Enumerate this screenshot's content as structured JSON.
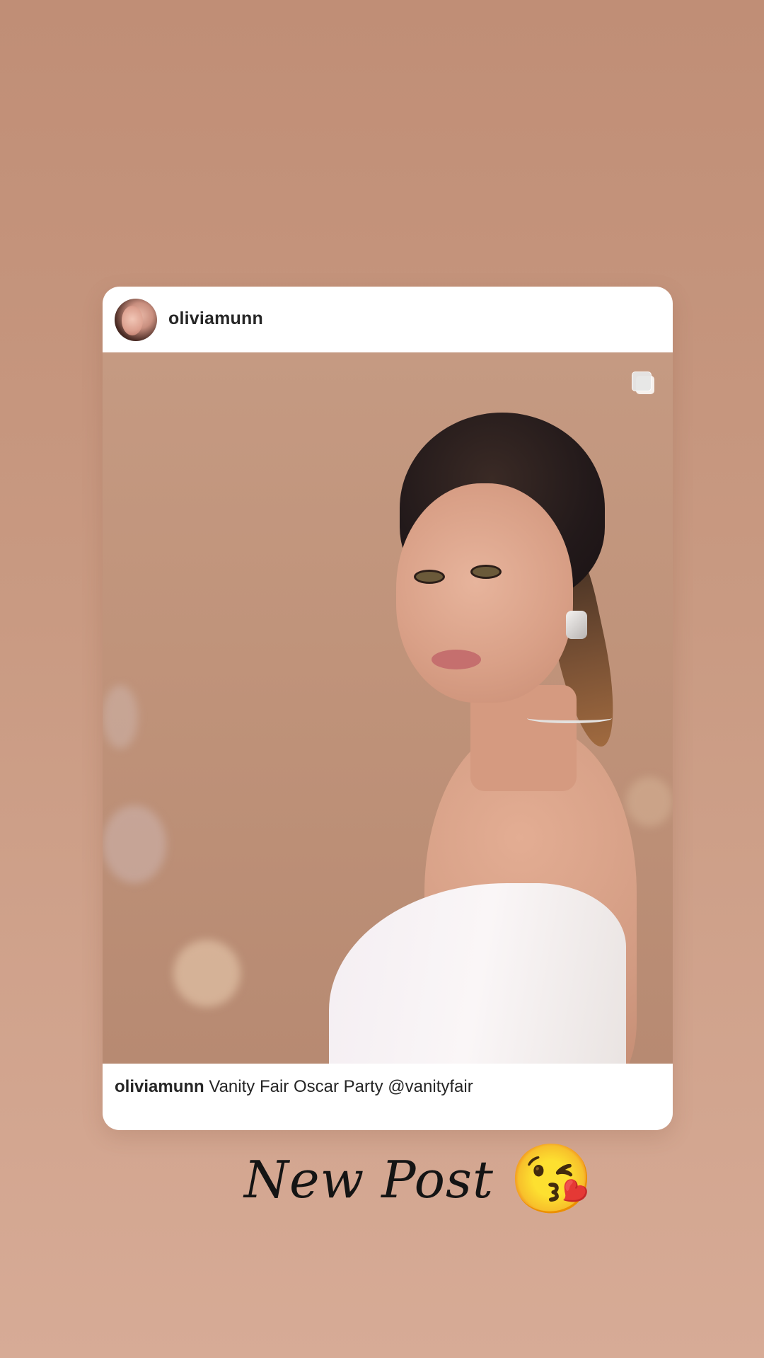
{
  "post": {
    "username": "oliviamunn",
    "caption": {
      "username": "oliviamunn",
      "text": "Vanity Fair Oscar Party @vanityfair"
    }
  },
  "story": {
    "sticker_text": "New Post",
    "emoji": "😘"
  },
  "icons": {
    "carousel": "multiple-photos-icon",
    "avatar": "profile-avatar"
  },
  "colors": {
    "background_top": "#c08e76",
    "background_bottom": "#d7ab96",
    "card": "#ffffff",
    "text": "#262626"
  }
}
